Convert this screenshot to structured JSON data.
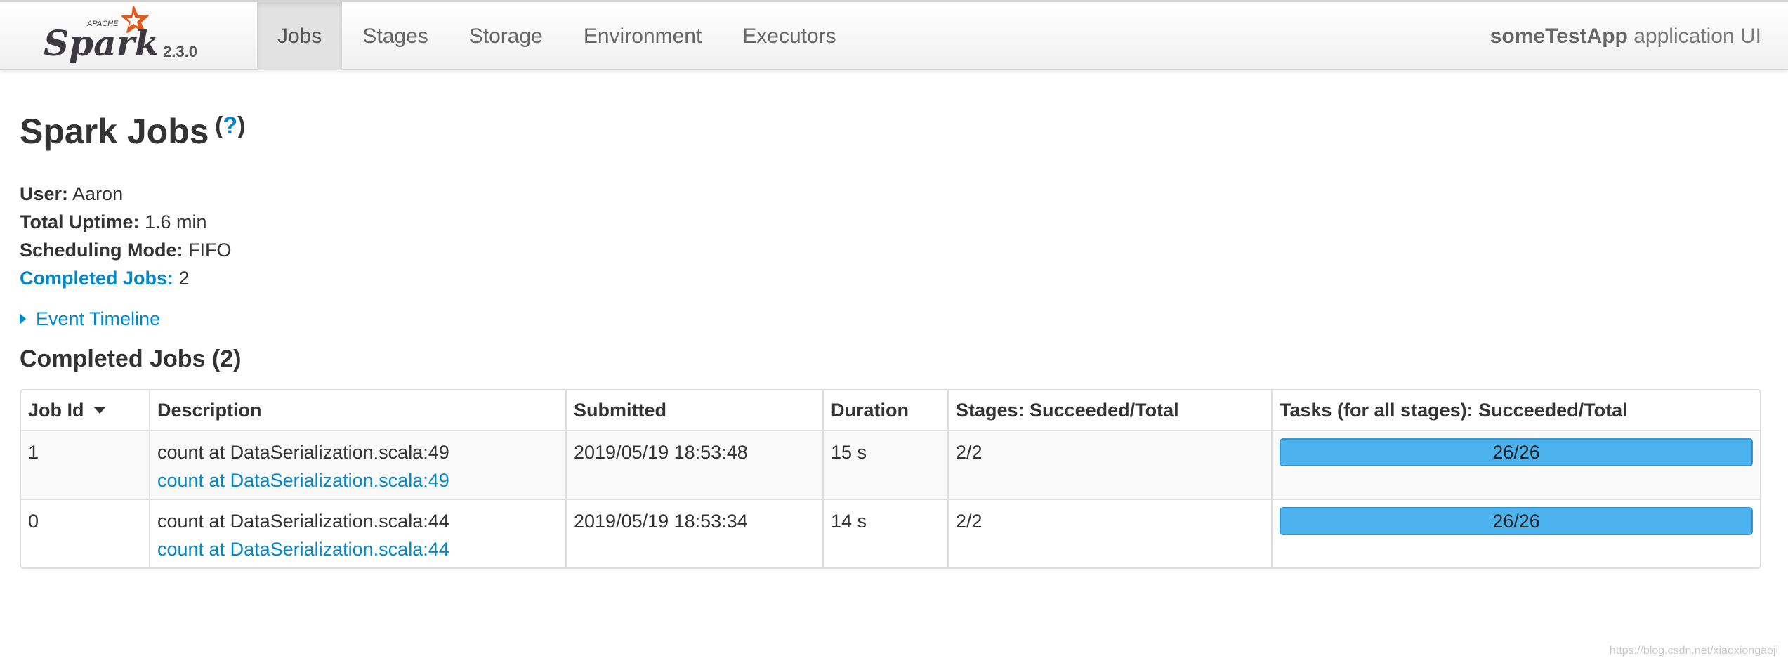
{
  "brand": {
    "logo_top_text": "APACHE",
    "logo_text": "Spark",
    "version": "2.3.0"
  },
  "nav": {
    "tabs": [
      {
        "label": "Jobs",
        "active": true
      },
      {
        "label": "Stages",
        "active": false
      },
      {
        "label": "Storage",
        "active": false
      },
      {
        "label": "Environment",
        "active": false
      },
      {
        "label": "Executors",
        "active": false
      }
    ],
    "app_name": "someTestApp",
    "app_suffix": " application UI"
  },
  "page": {
    "title": "Spark Jobs",
    "help_open": " (",
    "help_link": "?",
    "help_close": ")"
  },
  "summary": {
    "user_label": "User:",
    "user_value": " Aaron",
    "uptime_label": "Total Uptime:",
    "uptime_value": " 1.6 min",
    "mode_label": "Scheduling Mode:",
    "mode_value": " FIFO",
    "completed_label": "Completed Jobs:",
    "completed_value": " 2"
  },
  "timeline": {
    "label": "Event Timeline",
    "icon": "caret-right-icon"
  },
  "completed_section": {
    "title": "Completed Jobs (2)"
  },
  "table": {
    "headers": [
      "Job Id",
      "Description",
      "Submitted",
      "Duration",
      "Stages: Succeeded/Total",
      "Tasks (for all stages): Succeeded/Total"
    ],
    "rows": [
      {
        "job_id": "1",
        "description": "count at DataSerialization.scala:49",
        "description_link": "count at DataSerialization.scala:49",
        "submitted": "2019/05/19 18:53:48",
        "duration": "15 s",
        "stages": "2/2",
        "tasks": "26/26",
        "tasks_fraction": 1.0
      },
      {
        "job_id": "0",
        "description": "count at DataSerialization.scala:44",
        "description_link": "count at DataSerialization.scala:44",
        "submitted": "2019/05/19 18:53:34",
        "duration": "14 s",
        "stages": "2/2",
        "tasks": "26/26",
        "tasks_fraction": 1.0
      }
    ]
  },
  "watermark": "https://blog.csdn.net/xiaoxiongaoji",
  "colors": {
    "link": "#0088cc",
    "progress": "#4db3ee",
    "logo_orange": "#e25a1c",
    "logo_gray": "#3c3a3e"
  }
}
